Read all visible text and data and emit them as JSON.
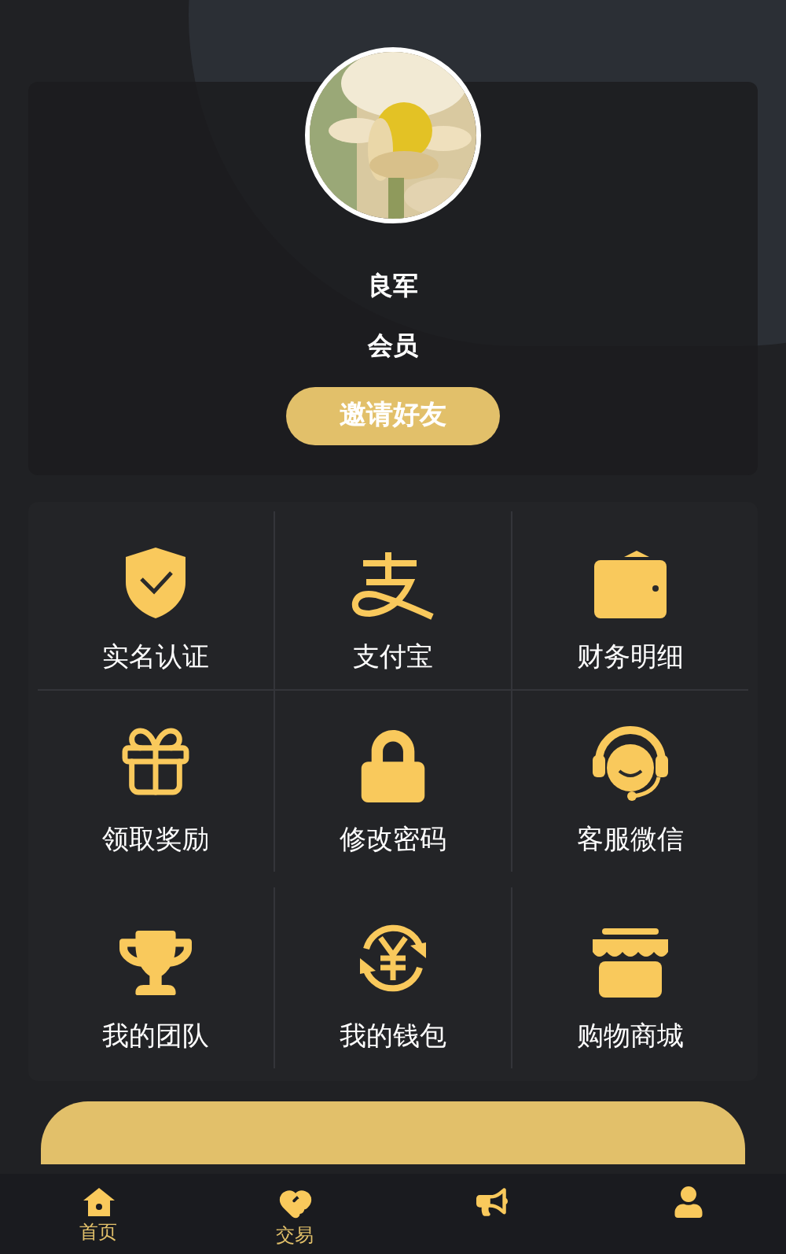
{
  "profile": {
    "name": "良军",
    "level": "会员",
    "invite_button": "邀请好友"
  },
  "menu": [
    {
      "label": "实名认证"
    },
    {
      "label": "支付宝"
    },
    {
      "label": "财务明细"
    },
    {
      "label": "领取奖励"
    },
    {
      "label": "修改密码"
    },
    {
      "label": "客服微信"
    },
    {
      "label": "我的团队"
    },
    {
      "label": "我的钱包"
    },
    {
      "label": "购物商城"
    }
  ],
  "bottom_nav": [
    {
      "kind": "labeled",
      "label": "首页"
    },
    {
      "kind": "labeled",
      "label": "交易"
    },
    {
      "kind": "icon"
    },
    {
      "kind": "icon"
    }
  ]
}
